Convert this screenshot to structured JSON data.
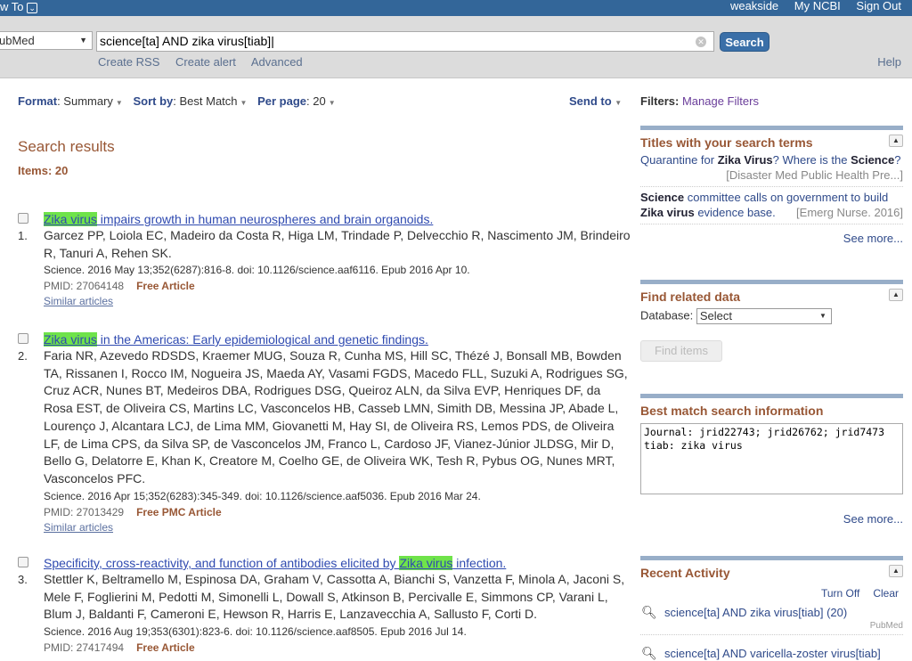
{
  "topbar": {
    "how_to": "w To",
    "links": [
      "weakside",
      "My NCBI",
      "Sign Out"
    ]
  },
  "search": {
    "database": "ubMed",
    "query": "science[ta] AND zika virus[tiab]",
    "button": "Search",
    "links": [
      "Create RSS",
      "Create alert",
      "Advanced"
    ],
    "help": "Help"
  },
  "toolbar": {
    "format_label": "Format",
    "format_value": "Summary",
    "sort_label": "Sort by",
    "sort_value": "Best Match",
    "perpage_label": "Per page",
    "perpage_value": "20",
    "send_to": "Send to"
  },
  "results_heading": "Search results",
  "items": "Items: 20",
  "results": [
    {
      "num": "1.",
      "title_pre": "",
      "title_hl": "Zika virus",
      "title_post": " impairs growth in human neurospheres and brain organoids.",
      "authors": "Garcez PP, Loiola EC, Madeiro da Costa R, Higa LM, Trindade P, Delvecchio R, Nascimento JM, Brindeiro R, Tanuri A, Rehen SK.",
      "citation": "Science. 2016 May 13;352(6287):816-8. doi: 10.1126/science.aaf6116. Epub 2016 Apr 10.",
      "pmid": "PMID: 27064148",
      "free": "Free Article",
      "similar": "Similar articles"
    },
    {
      "num": "2.",
      "title_pre": "",
      "title_hl": "Zika virus",
      "title_post": " in the Americas: Early epidemiological and genetic findings.",
      "authors": "Faria NR, Azevedo RDSDS, Kraemer MUG, Souza R, Cunha MS, Hill SC, Thézé J, Bonsall MB, Bowden TA, Rissanen I, Rocco IM, Nogueira JS, Maeda AY, Vasami FGDS, Macedo FLL, Suzuki A, Rodrigues SG, Cruz ACR, Nunes BT, Medeiros DBA, Rodrigues DSG, Queiroz ALN, da Silva EVP, Henriques DF, da Rosa EST, de Oliveira CS, Martins LC, Vasconcelos HB, Casseb LMN, Simith DB, Messina JP, Abade L, Lourenço J, Alcantara LCJ, de Lima MM, Giovanetti M, Hay SI, de Oliveira RS, Lemos PDS, de Oliveira LF, de Lima CPS, da Silva SP, de Vasconcelos JM, Franco L, Cardoso JF, Vianez-Júnior JLDSG, Mir D, Bello G, Delatorre E, Khan K, Creatore M, Coelho GE, de Oliveira WK, Tesh R, Pybus OG, Nunes MRT, Vasconcelos PFC.",
      "citation": "Science. 2016 Apr 15;352(6283):345-349. doi: 10.1126/science.aaf5036. Epub 2016 Mar 24.",
      "pmid": "PMID: 27013429",
      "free": "Free PMC Article",
      "similar": "Similar articles"
    },
    {
      "num": "3.",
      "title_pre": "Specificity, cross-reactivity, and function of antibodies elicited by ",
      "title_hl": "Zika virus",
      "title_post": " infection.",
      "authors": "Stettler K, Beltramello M, Espinosa DA, Graham V, Cassotta A, Bianchi S, Vanzetta F, Minola A, Jaconi S, Mele F, Foglierini M, Pedotti M, Simonelli L, Dowall S, Atkinson B, Percivalle E, Simmons CP, Varani L, Blum J, Baldanti F, Cameroni E, Hewson R, Harris E, Lanzavecchia A, Sallusto F, Corti D.",
      "citation": "Science. 2016 Aug 19;353(6301):823-6. doi: 10.1126/science.aaf8505. Epub 2016 Jul 14.",
      "pmid": "PMID: 27417494",
      "free": "Free Article",
      "similar": ""
    }
  ],
  "sidebar": {
    "filters_label": "Filters:",
    "manage_filters": "Manage Filters",
    "titles": {
      "heading": "Titles with your search terms",
      "items": [
        {
          "a": "Quarantine for ",
          "b": "Zika Virus",
          "c": "? Where is the ",
          "d": "Science",
          "e": "?",
          "src": "[Disaster Med Public Health Pre...]"
        },
        {
          "a": "",
          "b": "Science",
          "c": " committee calls on government to build ",
          "d": "Zika virus",
          "e": " evidence base.",
          "src": "[Emerg Nurse. 2016]"
        }
      ],
      "see_more": "See more..."
    },
    "related": {
      "heading": "Find related data",
      "db_label": "Database:",
      "db_value": "Select",
      "find": "Find items"
    },
    "bestmatch": {
      "heading": "Best match search information",
      "text": "Journal: jrid22743; jrid26762; jrid7473\ntiab: zika virus",
      "see_more": "See more..."
    },
    "recent": {
      "heading": "Recent Activity",
      "turn_off": "Turn Off",
      "clear": "Clear",
      "items": [
        {
          "text": "science[ta] AND zika virus[tiab] (20)",
          "db": "PubMed"
        },
        {
          "text": "science[ta] AND varicella-zoster virus[tiab]",
          "db": ""
        }
      ]
    }
  }
}
